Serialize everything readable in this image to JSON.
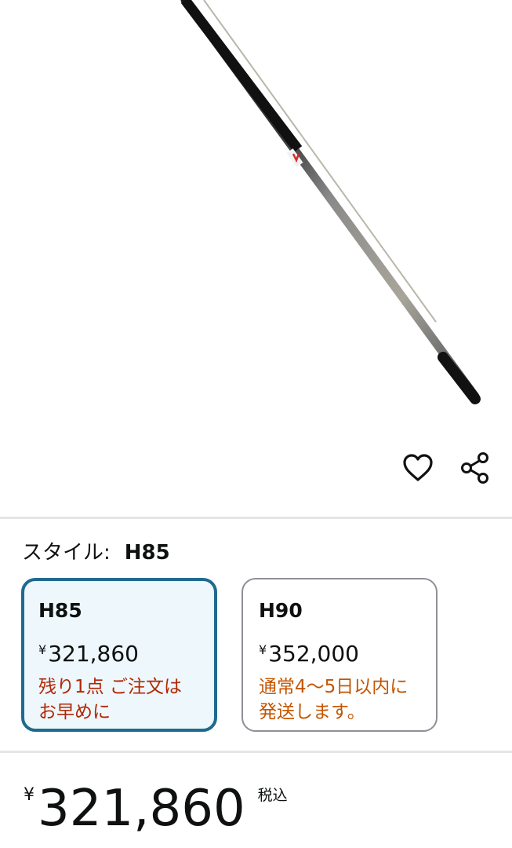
{
  "product": {
    "image_alt": "fishing-rod-product-image"
  },
  "actions": {
    "wishlist_icon": "heart-outline",
    "share_icon": "share-nodes"
  },
  "style_selector": {
    "label": "スタイル:",
    "selected_value": "H85",
    "options": [
      {
        "name": "H85",
        "currency": "¥",
        "price": "321,860",
        "availability_line1": "残り1点 ご注文は",
        "availability_line2": "お早めに",
        "availability_color": "#b12704",
        "selected": true
      },
      {
        "name": "H90",
        "currency": "¥",
        "price": "352,000",
        "availability_line1": "通常4～5日以内に",
        "availability_line2": "発送します。",
        "availability_color": "#c45500",
        "selected": false
      }
    ]
  },
  "price_block": {
    "currency": "¥",
    "amount": "321,860",
    "tax_label": "税込"
  },
  "colors": {
    "selected_border": "#1f6a8f",
    "selected_bg": "#edf7fc",
    "divider": "#e3e6e6"
  }
}
